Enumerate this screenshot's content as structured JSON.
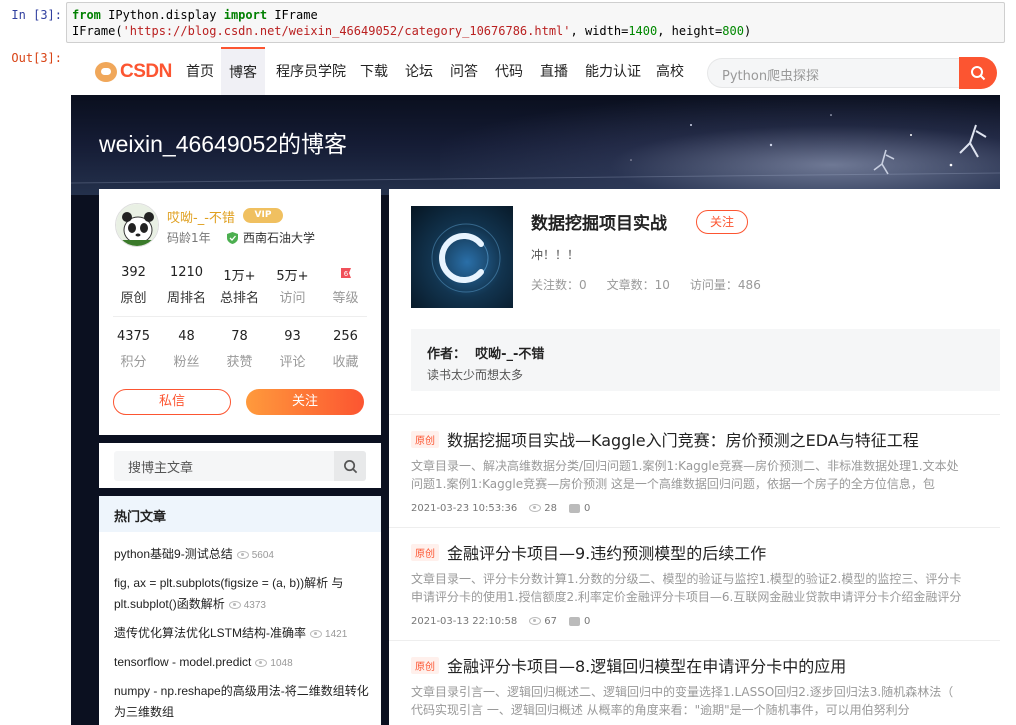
{
  "notebook": {
    "in_prompt": "In [3]:",
    "out_prompt": "Out[3]:",
    "code_line1": {
      "kw1": "from",
      "mod": " IPython.display ",
      "kw2": "import",
      "name": " IFrame"
    },
    "code_line2": {
      "fn": "IFrame(",
      "url": "'https://blog.csdn.net/weixin_46649052/category_10676786.html'",
      "rest1": ", width=",
      "w": "1400",
      "rest2": ", height=",
      "h": "800",
      "rest3": ")"
    }
  },
  "nav": {
    "logo": "CSDN",
    "items": [
      "首页",
      "博客",
      "程序员学院",
      "下载",
      "论坛",
      "问答",
      "代码",
      "直播",
      "能力认证",
      "高校"
    ],
    "active_index": 1,
    "search_placeholder": "Python爬虫探探"
  },
  "banner": {
    "title": "weixin_46649052的博客"
  },
  "profile": {
    "name": "哎呦-_-不错",
    "vip": "VIP",
    "code_age": "码龄1年",
    "school": "西南石油大学",
    "row1": [
      {
        "value": "392",
        "label": "原创"
      },
      {
        "value": "1210",
        "label": "周排名"
      },
      {
        "value": "1万+",
        "label": "总排名"
      },
      {
        "value": "5万+",
        "label": "访问"
      },
      {
        "value": "",
        "label": "等级"
      }
    ],
    "row2": [
      {
        "value": "4375",
        "label": "积分"
      },
      {
        "value": "48",
        "label": "粉丝"
      },
      {
        "value": "78",
        "label": "获赞"
      },
      {
        "value": "93",
        "label": "评论"
      },
      {
        "value": "256",
        "label": "收藏"
      }
    ],
    "msg_button": "私信",
    "follow_button": "关注"
  },
  "sidebar_search": {
    "placeholder": "搜博主文章"
  },
  "hot": {
    "heading": "热门文章",
    "items": [
      {
        "title": "python基础9-测试总结",
        "views": "5604"
      },
      {
        "title": "fig, ax = plt.subplots(figsize = (a, b))解析 与 plt.subplot()函数解析",
        "views": "4373"
      },
      {
        "title": "遗传优化算法优化LSTM结构-准确率",
        "views": "1421"
      },
      {
        "title": "tensorflow - model.predict",
        "views": "1048"
      },
      {
        "title": "numpy - np.reshape的高级用法-将二维数组转化为三维数组",
        "views": ""
      }
    ]
  },
  "category": {
    "title": "数据挖掘项目实战",
    "follow": "关注",
    "desc": "冲！！！",
    "followers": "关注数：0",
    "articles": "文章数：10",
    "visits": "访问量：486",
    "author_label": "作者：",
    "author_name": "哎呦-_-不错",
    "author_sig": "读书太少而想太多"
  },
  "articles": [
    {
      "tag": "原创",
      "title": "数据挖掘项目实战—Kaggle入门竞赛：房价预测之EDA与特征工程",
      "desc1": "文章目录一、解决高维数据分类/回归问题1.案例1:Kaggle竞赛—房价预测二、非标准数据处理1.文本处",
      "desc2": "问题1.案例1:Kaggle竞赛—房价预测      这是一个高维数据回归问题，依据一个房子的全方位信息，包",
      "date": "2021-03-23 10:53:36",
      "views": "28",
      "comments": "0"
    },
    {
      "tag": "原创",
      "title": "金融评分卡项目—9.违约预测模型的后续工作",
      "desc1": "文章目录一、评分卡分数计算1.分数的分级二、模型的验证与监控1.模型的验证2.模型的监控三、评分卡",
      "desc2": "申请评分卡的使用1.授信额度2.利率定价金融评分卡项目—6.互联网金融业贷款申请评分卡介绍金融评分",
      "date": "2021-03-13 22:10:58",
      "views": "67",
      "comments": "0"
    },
    {
      "tag": "原创",
      "title": "金融评分卡项目—8.逻辑回归模型在申请评分卡中的应用",
      "desc1": "文章目录引言一、逻辑回归概述二、逻辑回归中的变量选择1.LASSO回归2.逐步回归法3.随机森林法（",
      "desc2": "代码实现引言      一、逻辑回归概述      从概率的角度来看：\"逾期\"是一个随机事件，可以用伯努利分",
      "date": "",
      "views": "",
      "comments": ""
    }
  ],
  "colors": {
    "brand": "#fc5531",
    "banner": "#0b1020",
    "vip": "#f0c060"
  }
}
